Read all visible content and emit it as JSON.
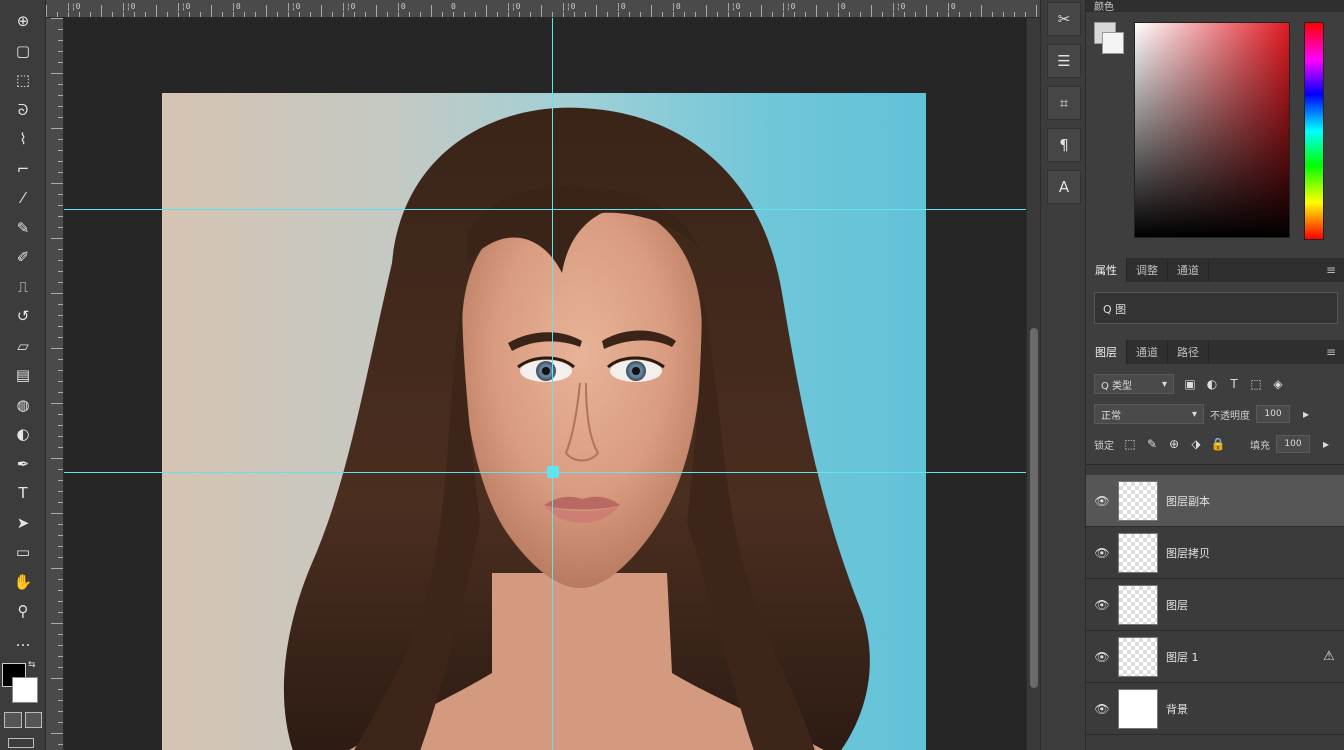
{
  "toolbar": {
    "tools": [
      {
        "name": "move-tool",
        "glyph": "⊕"
      },
      {
        "name": "artboard-tool",
        "glyph": "▢"
      },
      {
        "name": "marquee-tool",
        "glyph": "⬚"
      },
      {
        "name": "lasso-tool",
        "glyph": "ᘐ"
      },
      {
        "name": "quick-select-tool",
        "glyph": "⌇"
      },
      {
        "name": "crop-tool",
        "glyph": "⌐"
      },
      {
        "name": "eyedropper-tool",
        "glyph": "⁄"
      },
      {
        "name": "healing-tool",
        "glyph": "✎"
      },
      {
        "name": "brush-tool",
        "glyph": "✐"
      },
      {
        "name": "stamp-tool",
        "glyph": "⎍"
      },
      {
        "name": "history-brush-tool",
        "glyph": "↺"
      },
      {
        "name": "eraser-tool",
        "glyph": "▱"
      },
      {
        "name": "gradient-tool",
        "glyph": "▤"
      },
      {
        "name": "blur-tool",
        "glyph": "◍"
      },
      {
        "name": "dodge-tool",
        "glyph": "◐"
      },
      {
        "name": "pen-tool",
        "glyph": "✒"
      },
      {
        "name": "type-tool",
        "glyph": "T"
      },
      {
        "name": "path-select-tool",
        "glyph": "➤"
      },
      {
        "name": "shape-tool",
        "glyph": "▭"
      },
      {
        "name": "hand-tool",
        "glyph": "✋"
      },
      {
        "name": "zoom-tool",
        "glyph": "⚲"
      },
      {
        "name": "edit-toolbar",
        "glyph": "…"
      }
    ],
    "foreground_color": "#000000",
    "background_color": "#ffffff"
  },
  "rulers": {
    "top_labels": [
      "|¦0",
      "|¦0",
      "|¦0",
      "|0",
      "|¦0",
      "|¦0",
      "|0",
      "0",
      "|¦0",
      "|¦0",
      "|0",
      "|0",
      "|¦0",
      "|¦0",
      "|0",
      "|¦0",
      "|0"
    ]
  },
  "icon_strip": {
    "buttons": [
      {
        "name": "history-icon",
        "glyph": "✂"
      },
      {
        "name": "properties-icon",
        "glyph": "☰"
      },
      {
        "name": "brush-settings-icon",
        "glyph": "⌗"
      },
      {
        "name": "paragraph-icon",
        "glyph": "¶"
      },
      {
        "name": "character-icon",
        "glyph": "A"
      }
    ]
  },
  "color_panel": {
    "tab_label": "颜色"
  },
  "adjustments_panel": {
    "tabs": [
      "属性",
      "调整",
      "通道"
    ],
    "menu_icon": "≡",
    "field_text": "Q 图"
  },
  "layers_panel": {
    "tabs": [
      "图层",
      "通道",
      "路径"
    ],
    "menu_icon": "≡",
    "filter_dropdown": "Q 类型",
    "filter_icons": [
      "▣",
      "◐",
      "T",
      "⬚",
      "◈"
    ],
    "blend_mode": "正常",
    "opacity_label": "不透明度",
    "opacity_value": "100",
    "lock_label": "锁定",
    "lock_icons": [
      "⬚",
      "✎",
      "⊕",
      "⬗",
      "🔒"
    ],
    "fill_label": "填充",
    "fill_value": "100",
    "layers": [
      {
        "name": "图层副本",
        "visible": true,
        "selected": true,
        "thumb": "checker",
        "warning": false
      },
      {
        "name": "图层拷贝",
        "visible": true,
        "selected": false,
        "thumb": "checker",
        "warning": false
      },
      {
        "name": "图层",
        "visible": true,
        "selected": false,
        "thumb": "checker",
        "warning": false
      },
      {
        "name": "图层 1",
        "visible": true,
        "selected": false,
        "thumb": "checker",
        "warning": true
      },
      {
        "name": "背景",
        "visible": true,
        "selected": false,
        "thumb": "solid",
        "warning": false
      }
    ]
  }
}
